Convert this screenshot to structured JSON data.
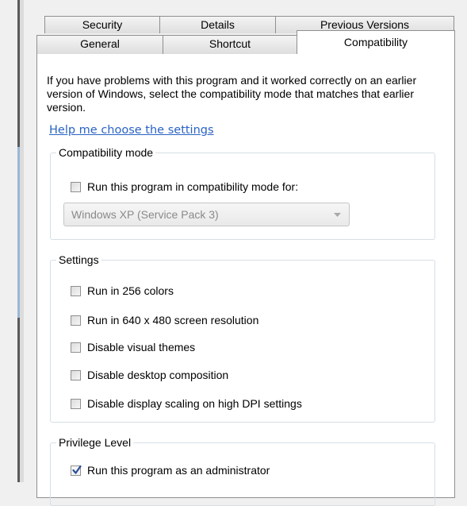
{
  "tabs": {
    "row1": [
      "Security",
      "Details",
      "Previous Versions"
    ],
    "row2": [
      "General",
      "Shortcut",
      "Compatibility"
    ],
    "active": "Compatibility"
  },
  "intro_text": "If you have problems with this program and it worked correctly on an earlier version of Windows, select the compatibility mode that matches that earlier version.",
  "help_link": "Help me choose the settings",
  "compat_mode": {
    "title": "Compatibility mode",
    "checkbox_label": "Run this program in compatibility mode for:",
    "checked": false,
    "dropdown_value": "Windows XP (Service Pack 3)",
    "dropdown_disabled": true
  },
  "settings": {
    "title": "Settings",
    "items": [
      {
        "label": "Run in 256 colors",
        "checked": false
      },
      {
        "label": "Run in 640 x 480 screen resolution",
        "checked": false
      },
      {
        "label": "Disable visual themes",
        "checked": false
      },
      {
        "label": "Disable desktop composition",
        "checked": false
      },
      {
        "label": "Disable display scaling on high DPI settings",
        "checked": false
      }
    ]
  },
  "privilege": {
    "title": "Privilege Level",
    "checkbox_label": "Run this program as an administrator",
    "checked": true
  },
  "icons": {
    "checkmark": "checkmark-icon",
    "dropdown": "chevron-down-icon"
  },
  "colors": {
    "link": "#2a63c4",
    "check": "#2b4f9a"
  }
}
